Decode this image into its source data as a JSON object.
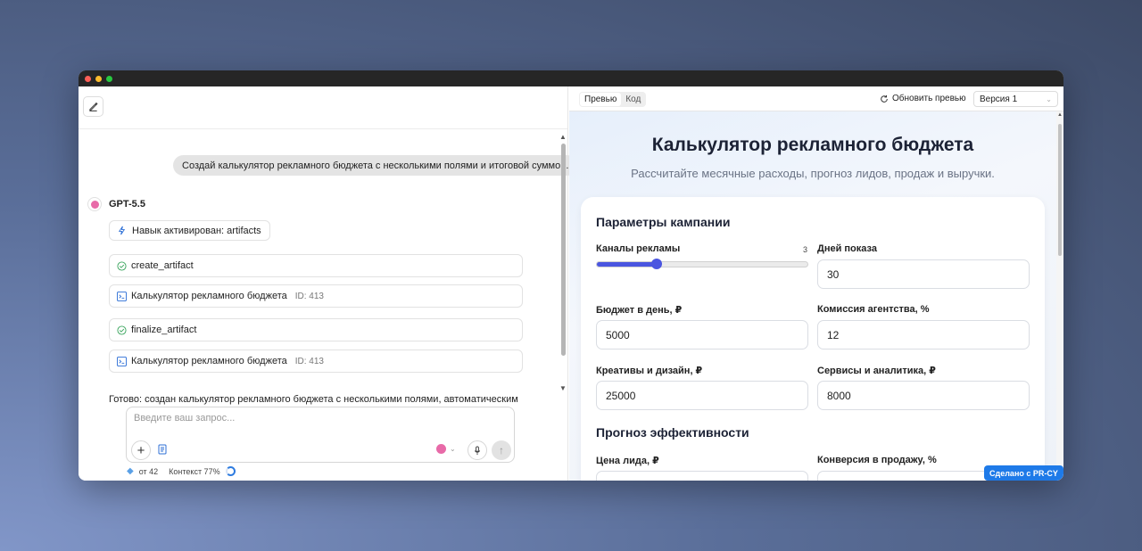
{
  "chat": {
    "user_message": "Создай калькулятор рекламного бюджета с несколькими полями и итоговой суммой.",
    "model_name": "GPT-5.5",
    "skill_chip": "Навык активирован: artifacts",
    "tools": [
      {
        "name": "create_artifact"
      },
      {
        "artifact": "Калькулятор рекламного бюджета",
        "id": "ID: 413"
      },
      {
        "name": "finalize_artifact"
      },
      {
        "artifact": "Калькулятор рекламного бюджета",
        "id": "ID: 413"
      }
    ],
    "done_text": "Готово: создан калькулятор рекламного бюджета с несколькими полями, автоматическим",
    "composer_placeholder": "Введите ваш запрос...",
    "credits": "от 42",
    "context": "Контекст 77%"
  },
  "preview_toolbar": {
    "tab_preview": "Превью",
    "tab_code": "Код",
    "refresh_label": "Обновить превью",
    "version_label": "Версия 1"
  },
  "app": {
    "title": "Калькулятор рекламного бюджета",
    "subtitle": "Рассчитайте месячные расходы, прогноз лидов, продаж и выручки.",
    "section_params": "Параметры кампании",
    "channels_label": "Каналы рекламы",
    "channels_value": "3",
    "channels_max": 8,
    "days_label": "Дней показа",
    "days_value": "30",
    "budget_label": "Бюджет в день, ₽",
    "budget_value": "5000",
    "commission_label": "Комиссия агентства, %",
    "commission_value": "12",
    "creatives_label": "Креативы и дизайн, ₽",
    "creatives_value": "25000",
    "services_label": "Сервисы и аналитика, ₽",
    "services_value": "8000",
    "section_forecast": "Прогноз эффективности",
    "lead_price_label": "Цена лида, ₽",
    "conversion_label": "Конверсия в продажу, %",
    "badge": "Сделано с PR-CY"
  }
}
